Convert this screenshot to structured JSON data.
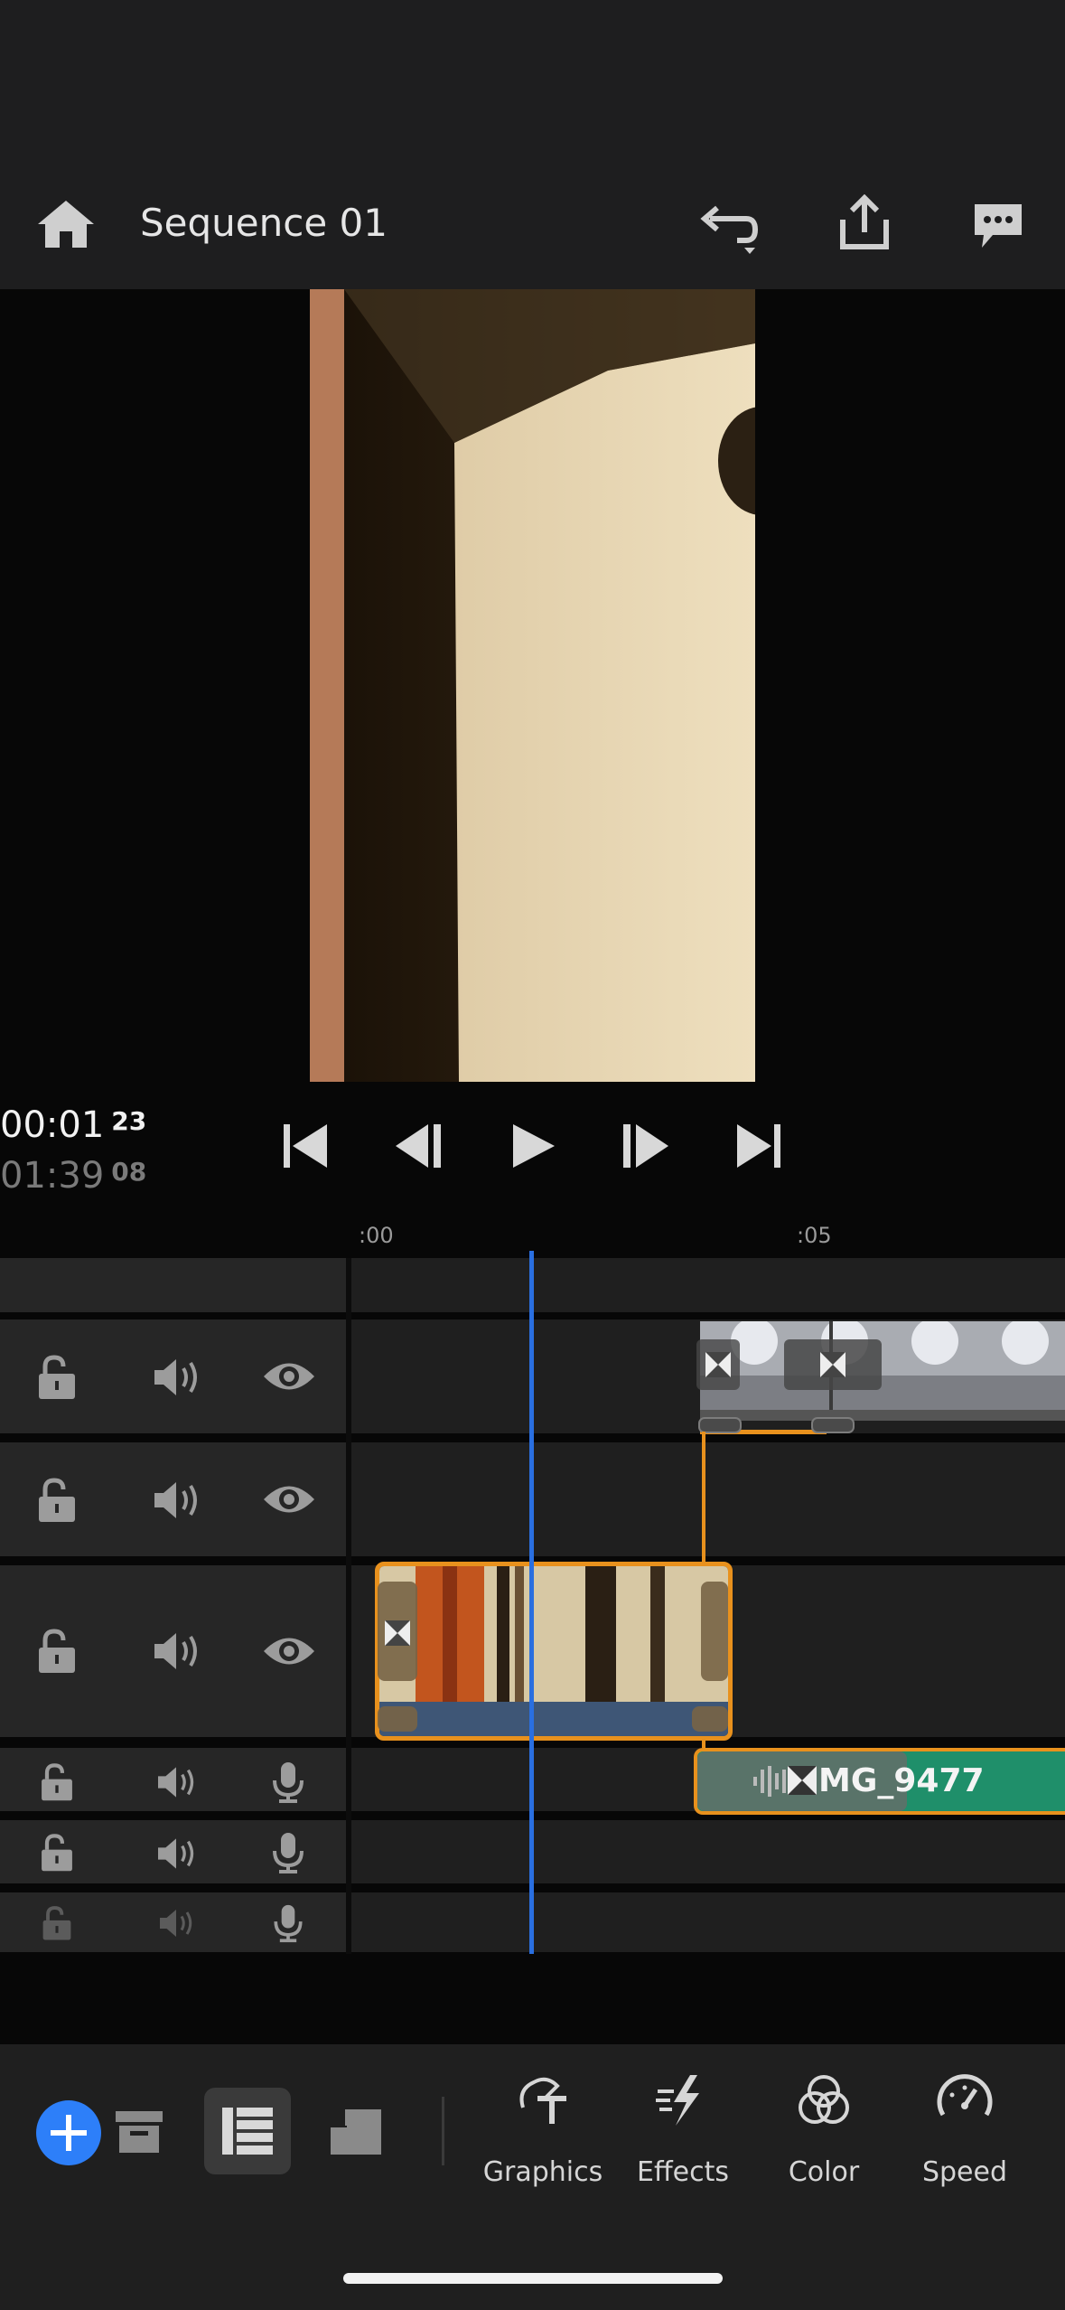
{
  "header": {
    "title": "Sequence 01"
  },
  "monitor": {
    "current_time": "00:01",
    "current_frame": "23",
    "duration": "01:39",
    "duration_frame": "08"
  },
  "ruler": {
    "ticks": [
      ":00",
      ":05"
    ]
  },
  "timeline": {
    "audio_clip_label": "IMG_9477",
    "audio_clip_visible_text": "MG_9477"
  },
  "toolbar": {
    "graphics_label": "Graphics",
    "effects_label": "Effects",
    "color_label": "Color",
    "speed_label": "Speed"
  },
  "colors": {
    "accent_blue": "#2d7ff9",
    "selection_orange": "#e8911d",
    "audio_green": "#1f8f6a",
    "playhead": "#2a6fe0"
  },
  "icons": [
    "home-icon",
    "undo-icon",
    "share-icon",
    "feedback-icon",
    "lock-icon",
    "speaker-icon",
    "eye-icon",
    "mic-icon",
    "transition-icon",
    "add-icon",
    "project-bin-icon",
    "timeline-list-icon",
    "layers-icon"
  ]
}
